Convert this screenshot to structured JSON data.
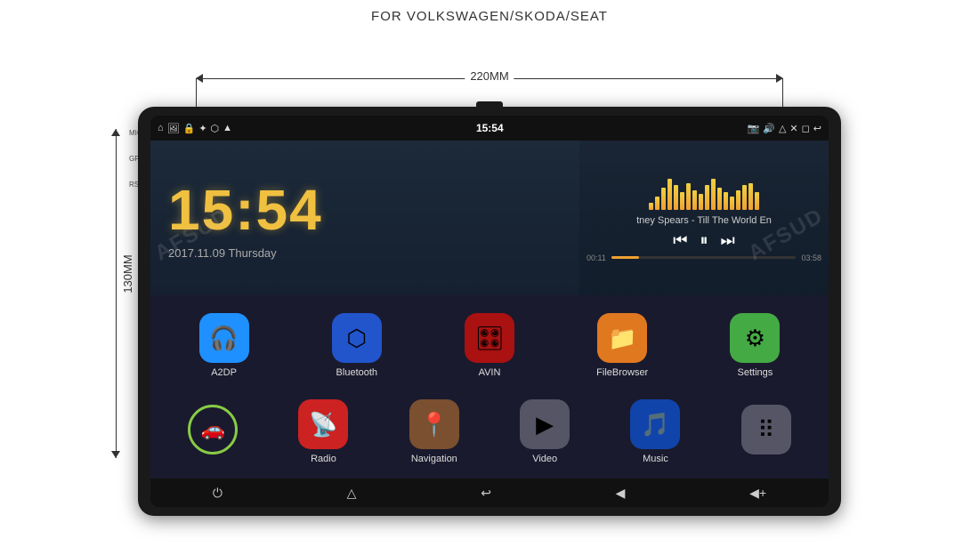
{
  "page": {
    "title": "FOR VOLKSWAGEN/SKODA/SEAT",
    "dim_horizontal": "220MM",
    "dim_vertical": "130MM"
  },
  "statusbar": {
    "time": "15:54",
    "left_icons": [
      "⌂",
      "🖼",
      "🔒",
      "✦"
    ],
    "right_icons": [
      "🔊",
      "△",
      "✕",
      "↩"
    ]
  },
  "clock": {
    "time": "15:54",
    "date": "2017.11.09 Thursday"
  },
  "music": {
    "track": "tney Spears - Till The World En",
    "time_current": "00:11",
    "time_total": "03:58",
    "eq_bars": [
      8,
      15,
      25,
      35,
      28,
      20,
      30,
      22,
      18,
      28,
      35,
      25,
      20,
      15,
      22,
      28,
      30,
      20
    ]
  },
  "apps_row1": [
    {
      "label": "A2DP",
      "icon": "🎧",
      "color": "icon-blue"
    },
    {
      "label": "Bluetooth",
      "icon": "⬡",
      "color": "icon-blue2"
    },
    {
      "label": "AVIN",
      "icon": "🎛",
      "color": "icon-dark-red"
    },
    {
      "label": "FileBrowser",
      "icon": "📁",
      "color": "icon-orange"
    },
    {
      "label": "Settings",
      "icon": "⚙",
      "color": "icon-green"
    }
  ],
  "apps_row2": [
    {
      "label": "",
      "icon": "🚗",
      "color": "icon-circle-green"
    },
    {
      "label": "Radio",
      "icon": "📡",
      "color": "icon-red"
    },
    {
      "label": "Navigation",
      "icon": "📍",
      "color": "icon-brown"
    },
    {
      "label": "Video",
      "icon": "▶",
      "color": "icon-gray"
    },
    {
      "label": "Music",
      "icon": "🎵",
      "color": "icon-dark-blue"
    },
    {
      "label": "",
      "icon": "⠿",
      "color": "icon-gray"
    }
  ],
  "navbar": {
    "buttons": [
      "⏻",
      "△",
      "↩",
      "◀",
      "◀+"
    ]
  },
  "side_labels": [
    "MIC",
    "GPS",
    "RST"
  ]
}
